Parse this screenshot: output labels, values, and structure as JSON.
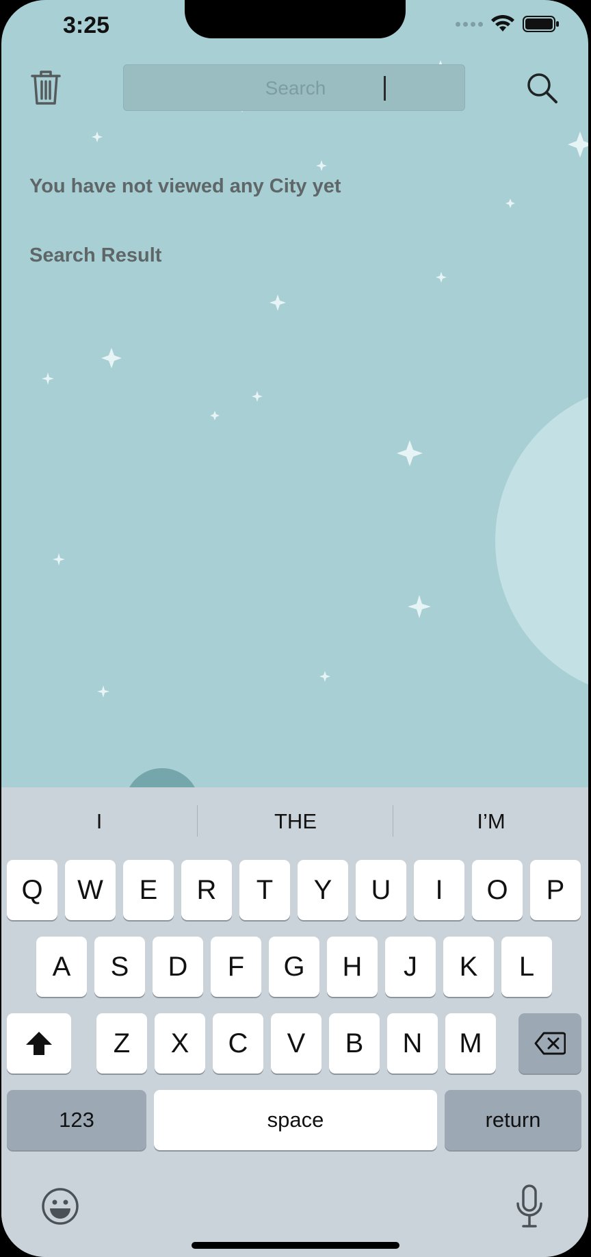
{
  "status_bar": {
    "time": "3:25"
  },
  "topbar": {
    "search_placeholder": "Search"
  },
  "content": {
    "empty_message": "You have not viewed any City yet",
    "section_title": "Search Result"
  },
  "keyboard": {
    "suggestions": [
      "I",
      "THE",
      "I’M"
    ],
    "row1": [
      "Q",
      "W",
      "E",
      "R",
      "T",
      "Y",
      "U",
      "I",
      "O",
      "P"
    ],
    "row2": [
      "A",
      "S",
      "D",
      "F",
      "G",
      "H",
      "J",
      "K",
      "L"
    ],
    "row3": [
      "Z",
      "X",
      "C",
      "V",
      "B",
      "N",
      "M"
    ],
    "numbers_label": "123",
    "space_label": "space",
    "return_label": "return"
  },
  "colors": {
    "background": "#a7cfd4",
    "keyboard": "#cbd3da",
    "text_muted": "#5f6668"
  },
  "icons": [
    "trash-icon",
    "search-icon",
    "shift-icon",
    "backspace-icon",
    "emoji-icon",
    "microphone-icon",
    "wifi-icon",
    "battery-icon"
  ]
}
